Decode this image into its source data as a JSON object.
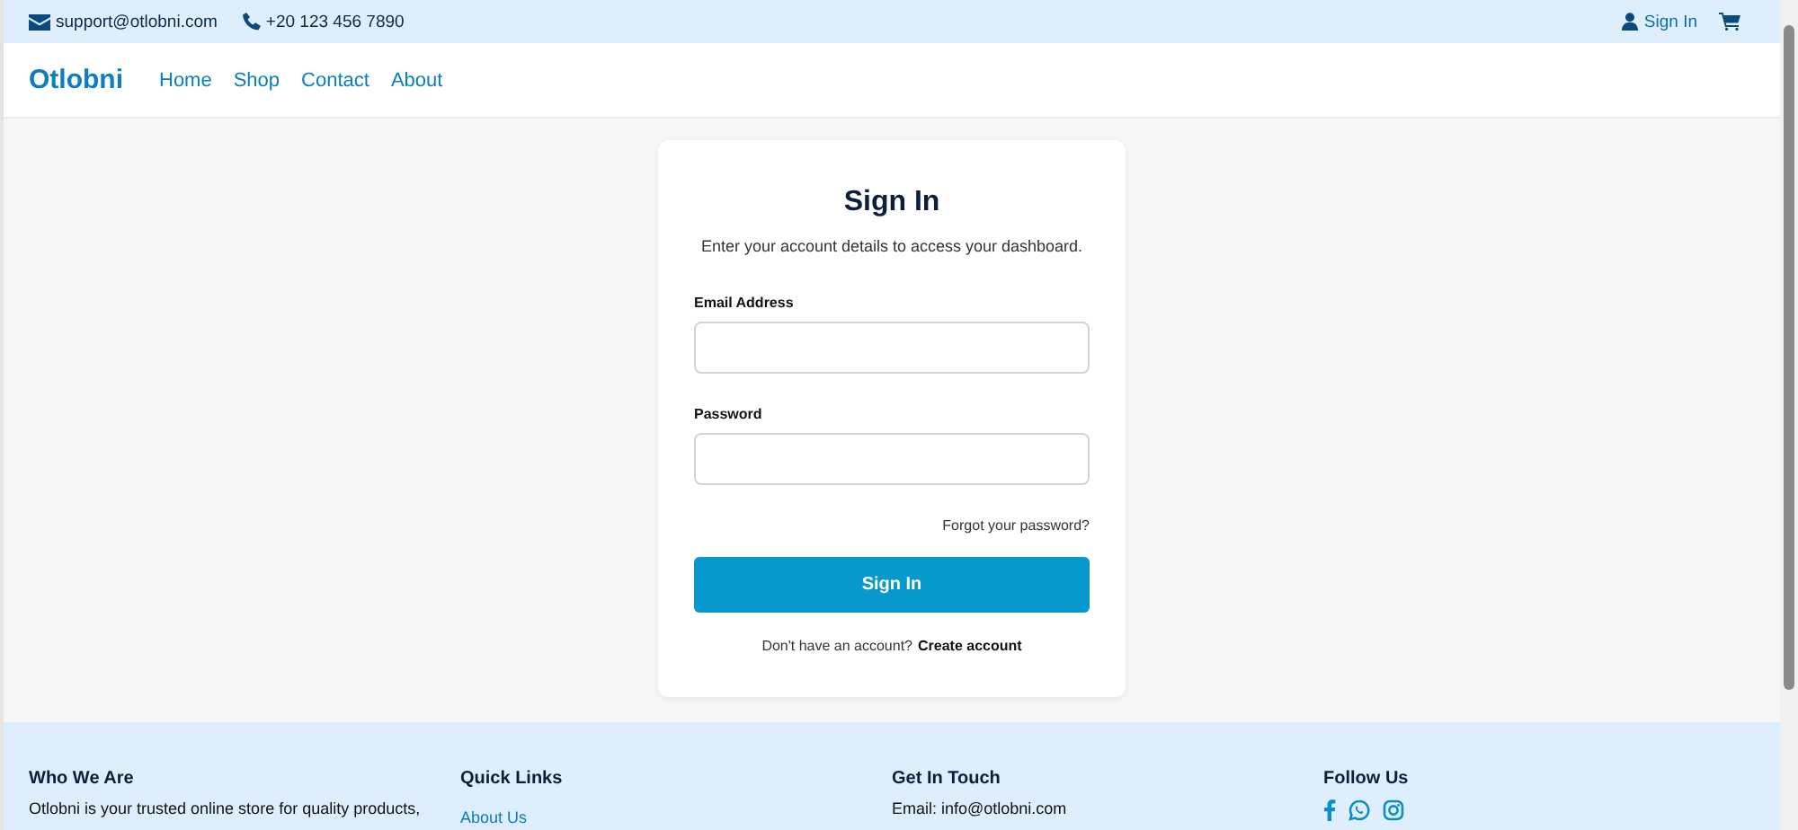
{
  "topbar": {
    "email": "support@otlobni.com",
    "phone": "+20 123 456 7890",
    "sign_in": "Sign In"
  },
  "navbar": {
    "brand": "Otlobni",
    "links": [
      {
        "label": "Home"
      },
      {
        "label": "Shop"
      },
      {
        "label": "Contact"
      },
      {
        "label": "About"
      }
    ]
  },
  "signin_card": {
    "title": "Sign In",
    "subtitle": "Enter your account details to access your dashboard.",
    "fields": [
      {
        "label": "Email Address"
      },
      {
        "label": "Password"
      }
    ],
    "forgot_link": "Forgot your password?",
    "submit_button": "Sign In",
    "register_prompt": "Don't have an account?",
    "register_link": "Create account"
  },
  "footer": {
    "columns": [
      {
        "heading": "Who We Are",
        "kind": "text",
        "text": "Otlobni is your trusted online store for quality products,"
      },
      {
        "heading": "Quick Links",
        "kind": "links",
        "links": [
          "About Us"
        ]
      },
      {
        "heading": "Get In Touch",
        "kind": "text",
        "text": "Email: info@otlobni.com"
      },
      {
        "heading": "Follow Us",
        "kind": "social"
      }
    ]
  }
}
